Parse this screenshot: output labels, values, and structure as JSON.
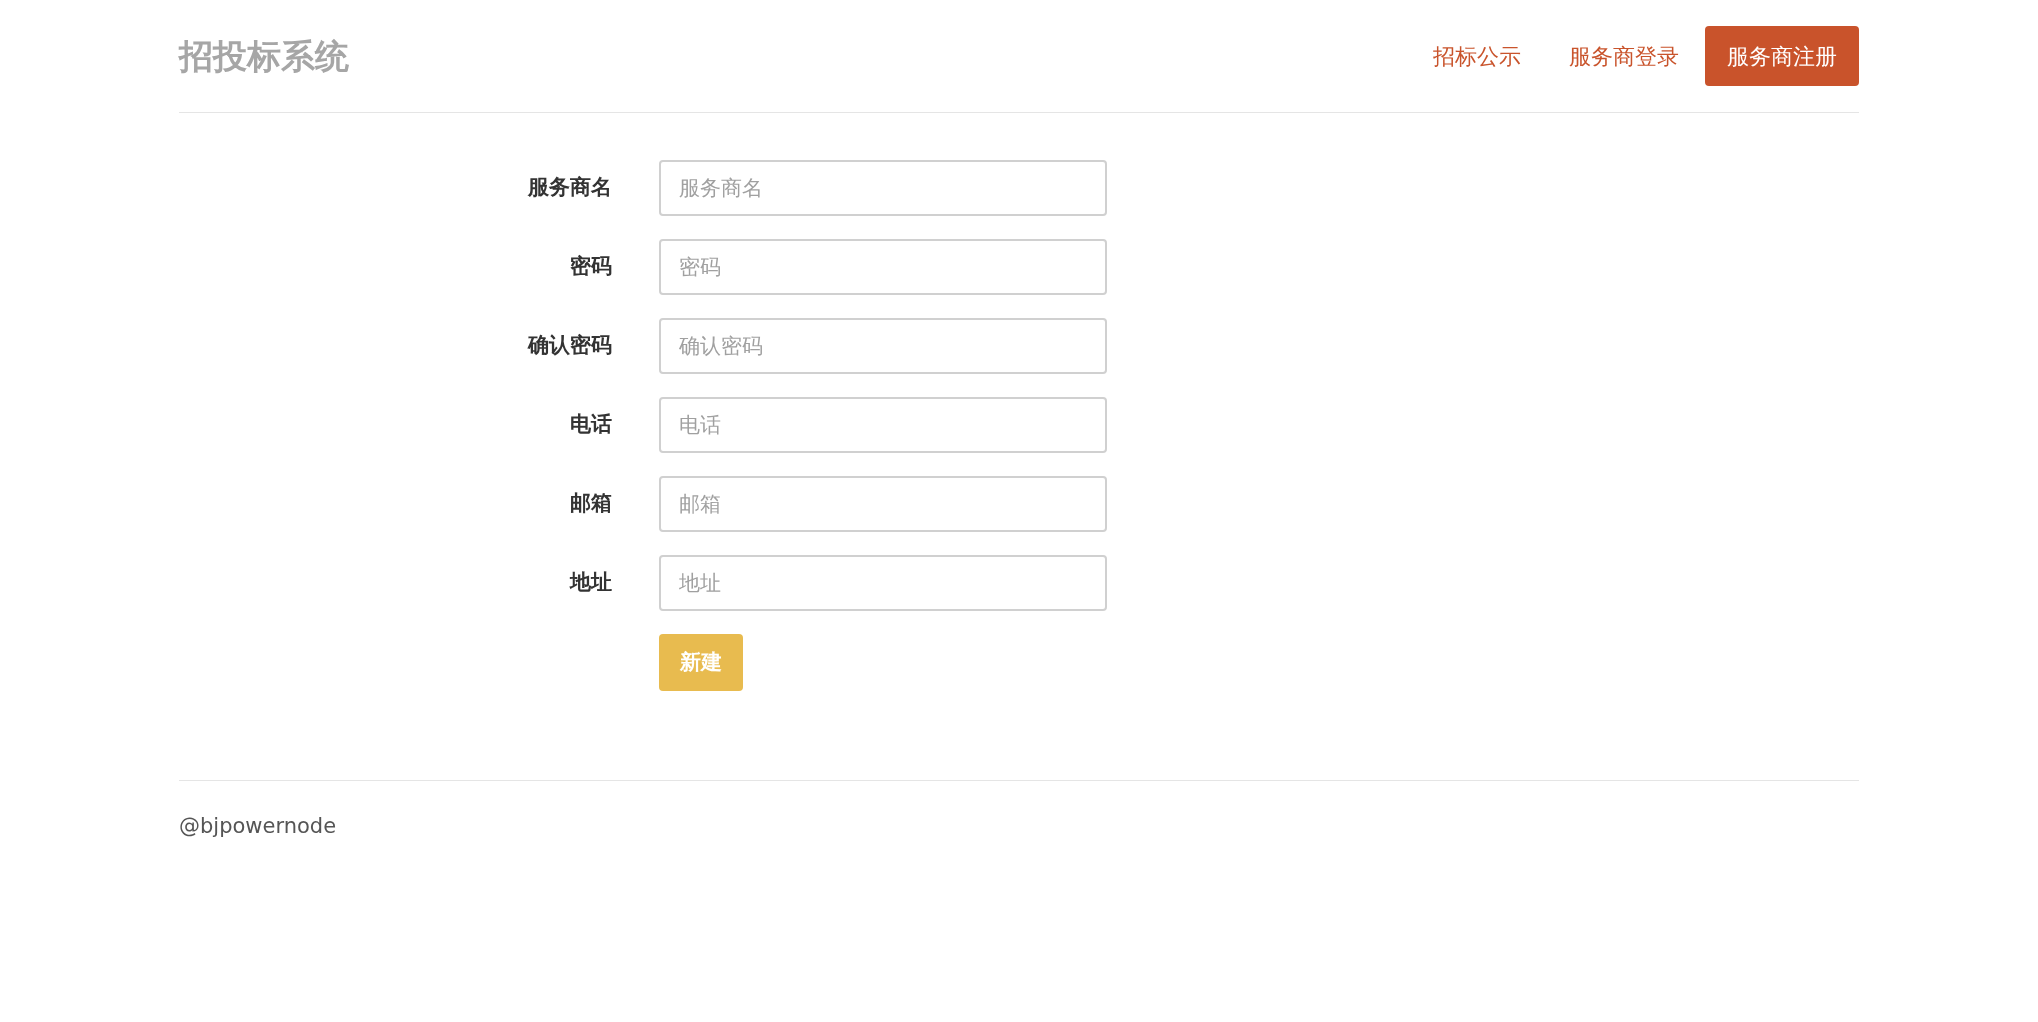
{
  "brand": "招投标系统",
  "nav": [
    {
      "label": "招标公示",
      "kind": "link"
    },
    {
      "label": "服务商登录",
      "kind": "link"
    },
    {
      "label": "服务商注册",
      "kind": "button"
    }
  ],
  "form": {
    "fields": [
      {
        "label": "服务商名",
        "placeholder": "服务商名"
      },
      {
        "label": "密码",
        "placeholder": "密码"
      },
      {
        "label": "确认密码",
        "placeholder": "确认密码"
      },
      {
        "label": "电话",
        "placeholder": "电话"
      },
      {
        "label": "邮箱",
        "placeholder": "邮箱"
      },
      {
        "label": "地址",
        "placeholder": "地址"
      }
    ],
    "submit": "新建"
  },
  "footer": "@bjpowernode"
}
